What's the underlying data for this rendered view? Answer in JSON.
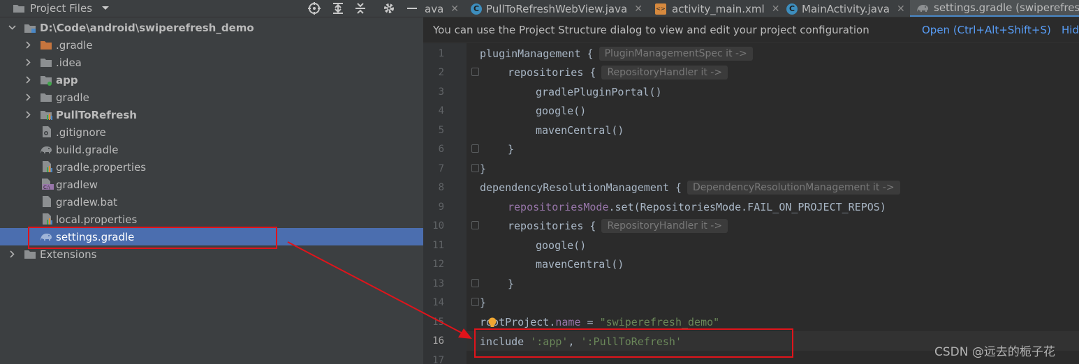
{
  "project_panel": {
    "title": "Project Files",
    "root": "D:\\Code\\android\\swiperefresh_demo",
    "items": [
      {
        "label": ".gradle",
        "icon": "folder-orange-icon",
        "expandable": true
      },
      {
        "label": ".idea",
        "icon": "folder-icon",
        "expandable": true
      },
      {
        "label": "app",
        "icon": "module-folder-icon",
        "expandable": true,
        "bold": true
      },
      {
        "label": "gradle",
        "icon": "folder-icon",
        "expandable": true
      },
      {
        "label": "PullToRefresh",
        "icon": "module-folder-icon",
        "expandable": true,
        "bold": true
      },
      {
        "label": ".gitignore",
        "icon": "gitignore-file-icon",
        "expandable": false
      },
      {
        "label": "build.gradle",
        "icon": "gradle-elephant-icon",
        "expandable": false
      },
      {
        "label": "gradle.properties",
        "icon": "properties-file-icon",
        "expandable": false
      },
      {
        "label": "gradlew",
        "icon": "shell-script-icon",
        "expandable": false
      },
      {
        "label": "gradlew.bat",
        "icon": "bat-file-icon",
        "expandable": false
      },
      {
        "label": "local.properties",
        "icon": "properties-file-icon",
        "expandable": false
      },
      {
        "label": "settings.gradle",
        "icon": "gradle-elephant-icon",
        "expandable": false,
        "selected": true
      }
    ],
    "extensions": "Extensions"
  },
  "tabs": [
    {
      "label": "ava",
      "icon": "java-file-icon",
      "active": false
    },
    {
      "label": "PullToRefreshWebView.java",
      "icon": "java-class-icon",
      "active": false
    },
    {
      "label": "activity_main.xml",
      "icon": "xml-file-icon",
      "active": false
    },
    {
      "label": "MainActivity.java",
      "icon": "java-class-icon",
      "active": false
    },
    {
      "label": "settings.gradle (swiperefresh",
      "icon": "gradle-elephant-icon",
      "active": true
    }
  ],
  "notification": {
    "text": "You can use the Project Structure dialog to view and edit your project configuration",
    "open_link": "Open (Ctrl+Alt+Shift+S)",
    "hide_link": "Hid"
  },
  "editor": {
    "current_line": 16,
    "lines": [
      {
        "n": "1",
        "indent": 0,
        "code": "pluginManagement {",
        "hint": "PluginManagementSpec it ->"
      },
      {
        "n": "2",
        "indent": 1,
        "code": "repositories {",
        "hint": "RepositoryHandler it ->"
      },
      {
        "n": "3",
        "indent": 2,
        "code": "gradlePluginPortal()"
      },
      {
        "n": "4",
        "indent": 2,
        "code": "google()"
      },
      {
        "n": "5",
        "indent": 2,
        "code": "mavenCentral()"
      },
      {
        "n": "6",
        "indent": 1,
        "code": "}"
      },
      {
        "n": "7",
        "indent": 0,
        "code": "}"
      },
      {
        "n": "8",
        "indent": 0,
        "code": "dependencyResolutionManagement {",
        "hint": "DependencyResolutionManagement it ->"
      },
      {
        "n": "9",
        "indent": 1,
        "code_prop": "repositoriesMode",
        "code": ".set(RepositoriesMode.FAIL_ON_PROJECT_REPOS)"
      },
      {
        "n": "10",
        "indent": 1,
        "code": "repositories {",
        "hint": "RepositoryHandler it ->"
      },
      {
        "n": "11",
        "indent": 2,
        "code": "google()"
      },
      {
        "n": "12",
        "indent": 2,
        "code": "mavenCentral()"
      },
      {
        "n": "13",
        "indent": 1,
        "code": "}"
      },
      {
        "n": "14",
        "indent": 0,
        "code": "}"
      },
      {
        "n": "15",
        "indent": 0,
        "code_pre": "rootProject.",
        "code_prop": "name",
        "code": " = ",
        "code_str": "\"swiperefresh_demo\""
      },
      {
        "n": "16",
        "indent": 0,
        "code": "include ",
        "code_str": "':app'",
        "code_mid": ", ",
        "code_str2": "':PullToRefresh'"
      },
      {
        "n": "17",
        "indent": 0,
        "code": ""
      }
    ]
  },
  "watermark": "CSDN @远去的栀子花",
  "colors": {
    "selection": "#4b6eaf",
    "annotation_red": "#e0141b",
    "link_blue": "#589df6"
  }
}
